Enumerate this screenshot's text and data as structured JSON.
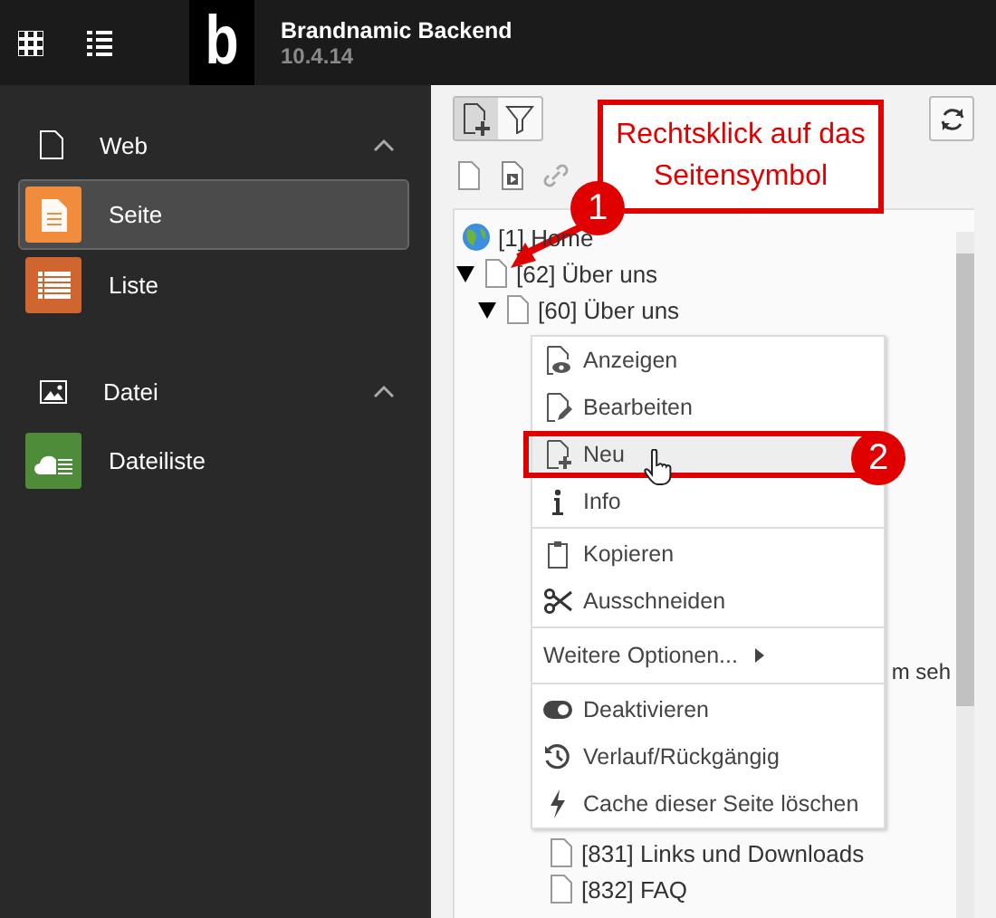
{
  "header": {
    "logo_letter": "b",
    "title": "Brandnamic Backend",
    "version": "10.4.14"
  },
  "sidebar": {
    "groups": [
      {
        "label": "Web",
        "expanded": true,
        "items": [
          {
            "label": "Seite",
            "selected": true,
            "color": "#f08c3c"
          },
          {
            "label": "Liste",
            "selected": false,
            "color": "#d0652f"
          }
        ]
      },
      {
        "label": "Datei",
        "expanded": true,
        "items": [
          {
            "label": "Dateiliste",
            "selected": false,
            "color": "#4e8c3a"
          }
        ]
      }
    ]
  },
  "toolbar": {
    "buttons": [
      {
        "selected": true
      },
      {
        "selected": false
      }
    ]
  },
  "tree": [
    {
      "label": "[1] Home",
      "kind": "root",
      "children": [
        {
          "label": "[62] Über uns",
          "kind": "page",
          "expanded": true,
          "children": [
            {
              "label": "[60] Über uns",
              "kind": "page",
              "expanded": true,
              "children": [
                {
                  "kind": "covered"
                },
                {
                  "kind": "covered"
                },
                {
                  "kind": "covered"
                },
                {
                  "kind": "covered"
                },
                {
                  "kind": "covered"
                },
                {
                  "kind": "covered"
                },
                {
                  "kind": "covered"
                },
                {
                  "kind": "covered"
                },
                {
                  "kind": "covered"
                },
                {
                  "label": "m seh",
                  "kind": "fragment"
                },
                {
                  "kind": "covered"
                },
                {
                  "kind": "covered"
                },
                {
                  "kind": "covered"
                },
                {
                  "kind": "covered",
                  "children": [
                    {
                      "label": "[831] Links und Downloads",
                      "kind": "page"
                    },
                    {
                      "label": "[832] FAQ",
                      "kind": "page"
                    }
                  ]
                }
              ]
            }
          ]
        }
      ]
    }
  ],
  "context_menu": [
    {
      "kind": "item",
      "label": "Anzeigen",
      "selected": false
    },
    {
      "kind": "item",
      "label": "Bearbeiten",
      "selected": false
    },
    {
      "kind": "item",
      "label": "Neu",
      "selected": true
    },
    {
      "kind": "item",
      "label": "Info",
      "selected": false
    },
    {
      "kind": "divider"
    },
    {
      "kind": "item",
      "label": "Kopieren",
      "selected": false
    },
    {
      "kind": "item",
      "label": "Ausschneiden",
      "selected": false
    },
    {
      "kind": "divider"
    },
    {
      "kind": "submenu",
      "label": "Weitere Optionen...",
      "selected": false
    },
    {
      "kind": "divider"
    },
    {
      "kind": "item",
      "label": "Deaktivieren",
      "selected": false
    },
    {
      "kind": "item",
      "label": "Verlauf/Rückgängig",
      "selected": false
    },
    {
      "kind": "item",
      "label": "Cache dieser Seite löschen",
      "selected": false
    }
  ],
  "annotations": {
    "callout": "Rechtsklick auf das Seitensymbol",
    "badges": [
      "1",
      "2"
    ]
  }
}
